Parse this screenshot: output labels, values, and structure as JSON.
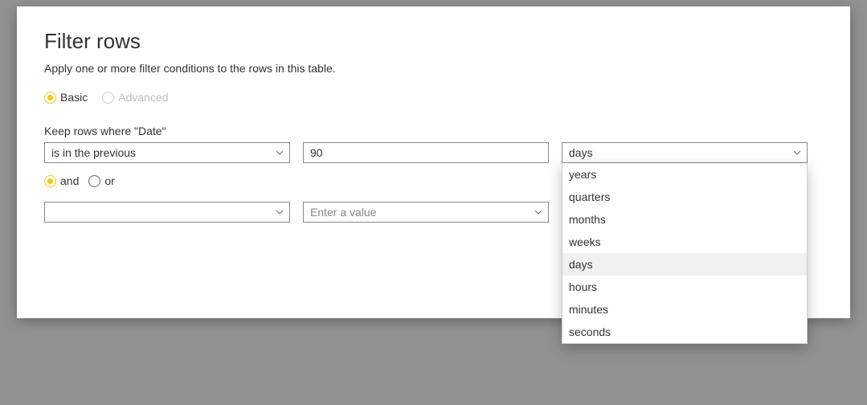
{
  "title": "Filter rows",
  "subtitle": "Apply one or more filter conditions to the rows in this table.",
  "mode": {
    "basic_label": "Basic",
    "advanced_label": "Advanced"
  },
  "keep_rows_label": "Keep rows where \"Date\"",
  "row1": {
    "operator": "is in the previous",
    "value": "90",
    "unit": "days"
  },
  "logic": {
    "and_label": "and",
    "or_label": "or"
  },
  "row2": {
    "operator": "",
    "value_placeholder": "Enter a value"
  },
  "unit_options": [
    "years",
    "quarters",
    "months",
    "weeks",
    "days",
    "hours",
    "minutes",
    "seconds"
  ],
  "unit_highlighted": "days"
}
